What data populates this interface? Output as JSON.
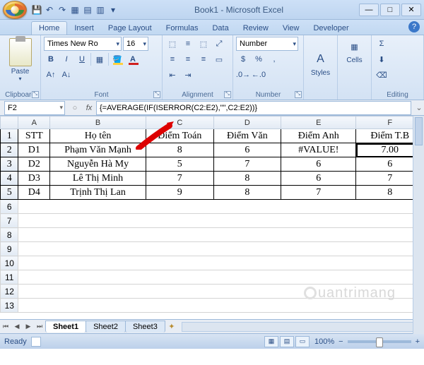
{
  "title": "Book1 - Microsoft Excel",
  "tabs": [
    "Home",
    "Insert",
    "Page Layout",
    "Formulas",
    "Data",
    "Review",
    "View",
    "Developer"
  ],
  "activeTab": "Home",
  "ribbon": {
    "clipboard": {
      "paste": "Paste",
      "label": "Clipboard"
    },
    "font": {
      "name": "Times New Ro",
      "size": "16",
      "label": "Font"
    },
    "alignment": {
      "label": "Alignment"
    },
    "number": {
      "format": "Number",
      "label": "Number"
    },
    "styles": {
      "label": "Styles"
    },
    "cells": {
      "label": "Cells"
    },
    "editing": {
      "label": "Editing"
    }
  },
  "namebox": "F2",
  "formula": "{=AVERAGE(IF(ISERROR(C2:E2),\"\",C2:E2))}",
  "columns": [
    "A",
    "B",
    "C",
    "D",
    "E",
    "F"
  ],
  "rows": [
    "1",
    "2",
    "3",
    "4",
    "5",
    "6",
    "7",
    "8",
    "9",
    "10",
    "11",
    "12",
    "13"
  ],
  "headers": [
    "STT",
    "Họ tên",
    "Điểm Toán",
    "Điểm Văn",
    "Điểm Anh",
    "Điểm T.B"
  ],
  "data": [
    [
      "D1",
      "Phạm Văn Mạnh",
      "8",
      "6",
      "#VALUE!",
      "7.00"
    ],
    [
      "D2",
      "Nguyễn Hà My",
      "5",
      "7",
      "6",
      "6"
    ],
    [
      "D3",
      "Lê Thị Minh",
      "7",
      "8",
      "6",
      "7"
    ],
    [
      "D4",
      "Trịnh Thị Lan",
      "9",
      "8",
      "7",
      "8"
    ]
  ],
  "selectedCell": "F2",
  "sheets": [
    "Sheet1",
    "Sheet2",
    "Sheet3"
  ],
  "activeSheet": "Sheet1",
  "status": {
    "ready": "Ready",
    "zoom": "100%"
  },
  "watermark": "uantrimang"
}
